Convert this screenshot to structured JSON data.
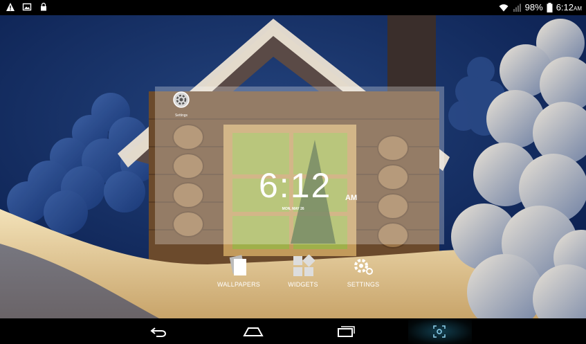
{
  "status_bar": {
    "left_icons": [
      "warning-icon",
      "image-icon",
      "lock-icon"
    ],
    "right_icons": [
      "wifi-icon",
      "signal-icon",
      "battery-icon"
    ],
    "battery": "98%",
    "time": "6:12",
    "time_suffix": "AM"
  },
  "panel": {
    "app_icon": "settings-app-icon",
    "app_label": "Settings"
  },
  "clock": {
    "time": "6:12",
    "ampm": "AM",
    "date": "MON, MAY 26"
  },
  "actions": [
    {
      "label": "WALLPAPERS",
      "icon": "wallpapers-icon"
    },
    {
      "label": "WIDGETS",
      "icon": "widgets-icon"
    },
    {
      "label": "SETTINGS",
      "icon": "settings-gear-icon"
    }
  ],
  "nav_bar": {
    "buttons": [
      "back-icon",
      "home-icon",
      "recents-icon",
      "screenshot-icon"
    ]
  },
  "colors": {
    "sky": "#0d2559",
    "snow": "#e8d3a6",
    "cabin": "#6b4a2c",
    "accent": "#33b5e5"
  }
}
